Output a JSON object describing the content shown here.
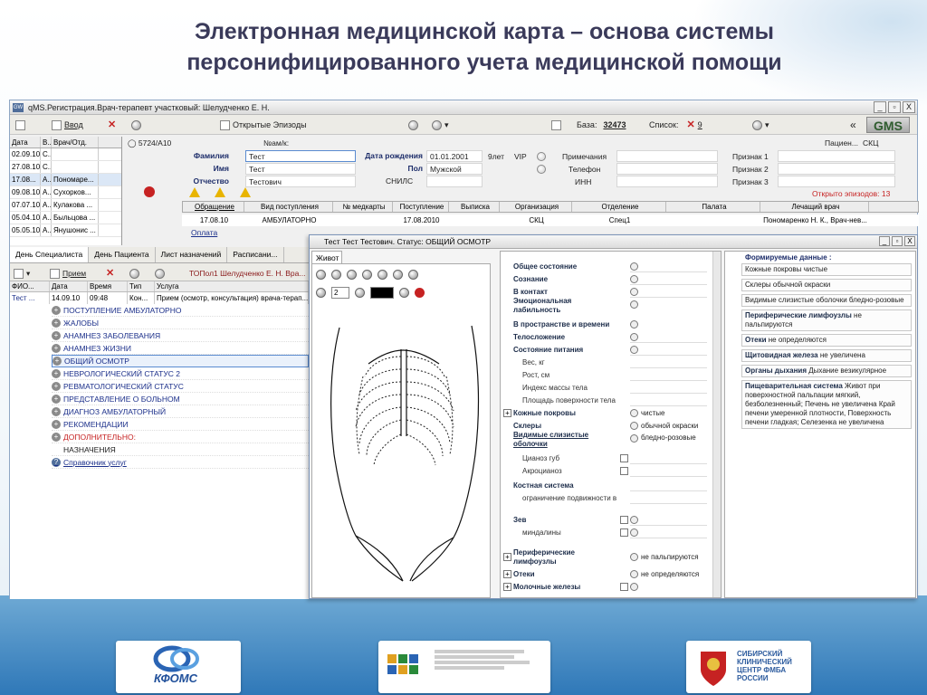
{
  "slide": {
    "title_line1": "Электронная медицинской карта – основа системы",
    "title_line2": "персонифицированного учета медицинской помощи"
  },
  "window": {
    "title": "qMS.Регистрация.Врач-терапевт участковый: Шелудченко Е. Н.",
    "app_icon": "GW",
    "min": "_",
    "max": "▫",
    "close": "X"
  },
  "toolbar": {
    "enter": "Ввод",
    "open_episodes": "Открытые Эпизоды",
    "base_label": "База:",
    "base_value": "32473",
    "list_label": "Список:",
    "list_value": "9",
    "logo": "GMS",
    "prev": "«"
  },
  "datelist": {
    "headers": [
      "Дата",
      "В...",
      "Врач/Отд."
    ],
    "rows": [
      {
        "date": "02.09.10",
        "b": "С...",
        "doc": ""
      },
      {
        "date": "27.08.10",
        "b": "С...",
        "doc": ""
      },
      {
        "date": "17.08...",
        "b": "А...",
        "doc": "Пономаре..."
      },
      {
        "date": "09.08.10",
        "b": "А...",
        "doc": "Сухорков..."
      },
      {
        "date": "07.07.10",
        "b": "А...",
        "doc": "Кулакова ..."
      },
      {
        "date": "05.04.10",
        "b": "А...",
        "doc": "Быльцова ..."
      },
      {
        "date": "05.05.10",
        "b": "А...",
        "doc": "Янушонис ..."
      }
    ]
  },
  "patient": {
    "id": "5724/А10",
    "num_label": "№ам/к:",
    "patient_tab": "Пациен...",
    "patient_tab2": "СКЦ",
    "surname_label": "Фамилия",
    "surname": "Тест",
    "name_label": "Имя",
    "name": "Тест",
    "patronymic_label": "Отчество",
    "patronymic": "Тестович",
    "dob_label": "Дата рождения",
    "dob": "01.01.2001",
    "age": "9лет",
    "vip": "VIP",
    "sex_label": "Пол",
    "sex": "Мужской",
    "snils": "СНИЛС",
    "notes": "Примечания",
    "phone": "Телефон",
    "inn": "ИНН",
    "sign1": "Признак 1",
    "sign2": "Признак 2",
    "sign3": "Признак 3",
    "open_episodes": "Открыто эпизодов: 13",
    "payment": "Оплата"
  },
  "episodes": {
    "headers": [
      "Обращение",
      "Вид поступления",
      "№ медкарты",
      "Поступление",
      "Выписка",
      "Организация",
      "Отделение",
      "Палата",
      "Лечащий врач"
    ],
    "row": [
      "17.08.10",
      "АМБУЛАТОРНО",
      "",
      "17.08.2010",
      "",
      "СКЦ",
      "Спец1",
      "",
      "Пономаренко Н. К., Врач-нев..."
    ]
  },
  "lower": {
    "tabs": [
      "День Специалиста",
      "День Пациента",
      "Лист назначений",
      "Расписани..."
    ],
    "reception": "Прием",
    "doctor_header": "ТОПол1 Шелудченко Е. Н. Вра...",
    "visit_headers": [
      "ФИО...",
      "Дата",
      "Время",
      "Тип",
      "Услуга"
    ],
    "visit_row": [
      "Тест ...",
      "14.09.10",
      "09:48",
      "Кон...",
      "Прием (осмотр, консультация) врача-терап..."
    ],
    "tree": [
      "ПОСТУПЛЕНИЕ АМБУЛАТОРНО",
      "ЖАЛОБЫ",
      "АНАМНЕЗ ЗАБОЛЕВАНИЯ",
      "АНАМНЕЗ ЖИЗНИ",
      "ОБЩИЙ ОСМОТР",
      "НЕВРОЛОГИЧЕСКИЙ СТАТУС 2",
      "РЕВМАТОЛОГИЧЕСКИЙ СТАТУС",
      "ПРЕДСТАВЛЕНИЕ О БОЛЬНОМ",
      "ДИАГНОЗ АМБУЛАТОРНЫЙ",
      "РЕКОМЕНДАЦИИ",
      "ДОПОЛНИТЕЛЬНО:",
      "НАЗНАЧЕНИЯ",
      "Справочник услуг"
    ]
  },
  "popup": {
    "title": "Тест Тест Тестович. Статус: ОБЩИЙ ОСМОТР",
    "tab": "Живот",
    "pen_size": "2",
    "form": [
      {
        "label": "Общее состояние",
        "kind": "rb"
      },
      {
        "label": "Сознание",
        "kind": "rb"
      },
      {
        "label": "В контакт",
        "kind": "rb"
      },
      {
        "label": "Эмоциональная",
        "label2": "лабильность",
        "kind": "rb"
      },
      {
        "label": "В пространстве и времени",
        "kind": "rb"
      },
      {
        "label": "Телосложение",
        "kind": "rb"
      },
      {
        "label": "Состояние питания",
        "kind": "rb"
      },
      {
        "label": "Вес, кг",
        "kind": "sub"
      },
      {
        "label": "Рост, см",
        "kind": "sub"
      },
      {
        "label": "Индекс массы тела",
        "kind": "sub"
      },
      {
        "label": "Площадь поверхности тела",
        "kind": "sub"
      },
      {
        "label": "Кожные покровы",
        "kind": "rbval",
        "value": "чистые"
      },
      {
        "label": "Склеры",
        "kind": "rbval",
        "value": "обычной окраски"
      },
      {
        "label": "Видимые слизистые",
        "label2": "оболочки",
        "kind": "rbval",
        "value": "бледно-розовые"
      },
      {
        "label": "Цианоз губ",
        "kind": "subcb"
      },
      {
        "label": "Акроцианоз",
        "kind": "subcb"
      },
      {
        "label": "Костная система",
        "kind": "head"
      },
      {
        "label": "ограничение подвижности в",
        "kind": "sub"
      },
      {
        "label": "Зев",
        "kind": "cbrb"
      },
      {
        "label": "миндалины",
        "kind": "subcbrb"
      },
      {
        "label": "Периферические",
        "label2": "лимфоузлы",
        "kind": "rbval",
        "value": "не пальпируются"
      },
      {
        "label": "Отеки",
        "kind": "rbval",
        "value": "не определяются"
      },
      {
        "label": "Молочные железы",
        "kind": "cbrb"
      }
    ],
    "summary_title": "Формируемые данные :",
    "summary": [
      {
        "b": "",
        "t": "Кожные покровы чистые"
      },
      {
        "b": "",
        "t": "Склеры обычной окраски"
      },
      {
        "b": "",
        "t": "Видимые слизистые оболочки бледно-розовые"
      },
      {
        "b": "Периферические лимфоузлы",
        "t": " не пальпируются"
      },
      {
        "b": "Отеки",
        "t": " не определяются"
      },
      {
        "b": "Щитовидная железа",
        "t": " не увеличена"
      },
      {
        "b": "Органы дыхания",
        "t": " Дыхание везикулярное"
      },
      {
        "b": "Пищеварительная система",
        "t": " Живот при поверхностной пальпации мягкий, безболезненный; Печень не увеличена  Край печени умеренной плотности, Поверхность печени гладкая; Селезенка не увеличена"
      }
    ]
  },
  "logos": {
    "kfoms": "КФОМС",
    "siberian": "СИБИРСКИЙ КЛИНИЧЕСКИЙ ЦЕНТР ФМБА РОССИИ"
  },
  "colors": {
    "accent": "#1d2d6a",
    "bottom_band": "#2f78b8",
    "warn": "#e8b400"
  }
}
